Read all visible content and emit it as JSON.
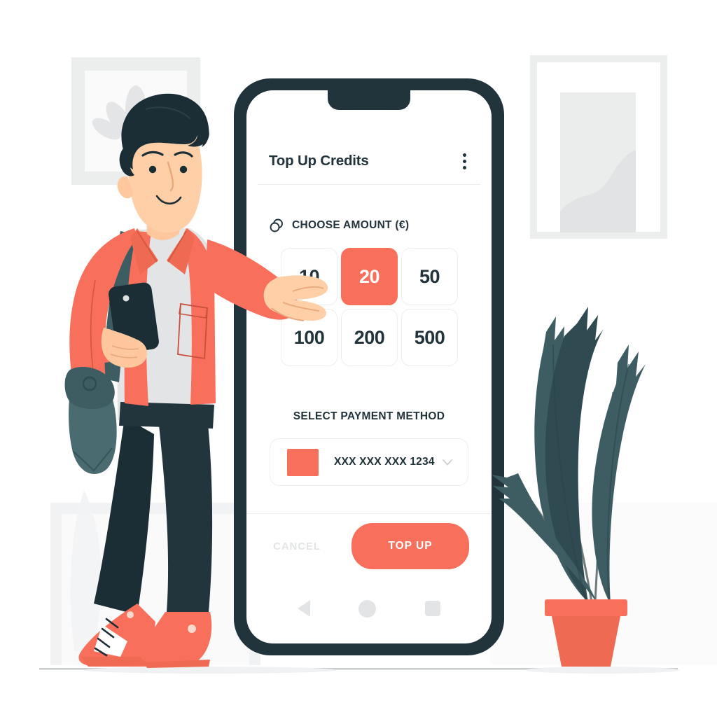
{
  "app": {
    "header": {
      "title": "Top Up Credits",
      "menu_icon": "kebab-menu-icon"
    },
    "amount_section": {
      "icon": "coins-icon",
      "label": "CHOOSE AMOUNT (€)",
      "currency": "€",
      "options": [
        {
          "value": "10",
          "selected": false
        },
        {
          "value": "20",
          "selected": true
        },
        {
          "value": "50",
          "selected": false
        },
        {
          "value": "100",
          "selected": false
        },
        {
          "value": "200",
          "selected": false
        },
        {
          "value": "500",
          "selected": false
        }
      ],
      "selected_value": "20"
    },
    "payment_section": {
      "label": "SELECT PAYMENT METHOD",
      "selected_card": "XXX XXX XXX 1234",
      "card_swatch_color": "#f8705c",
      "dropdown_icon": "chevron-down-icon"
    },
    "actions": {
      "cancel_label": "CANCEL",
      "submit_label": "TOP UP"
    },
    "nav_bar": {
      "back_icon": "back-triangle-icon",
      "home_icon": "home-circle-icon",
      "recents_icon": "recents-square-icon"
    }
  },
  "illustration": {
    "scene": "person-pointing-at-phone-topup-screen",
    "person": "man-with-shoulder-bag-holding-phone",
    "plant": "potted-banana-leaf-plant",
    "wall_art": [
      "square-lotus-picture-frame",
      "tall-abstract-picture-frame"
    ]
  },
  "colors": {
    "accent": "#f8705c",
    "dark": "#21333b",
    "teal": "#3d5d63",
    "skin": "#ffcfa8",
    "light_grey": "#e9eaec",
    "background": "#ffffff"
  }
}
